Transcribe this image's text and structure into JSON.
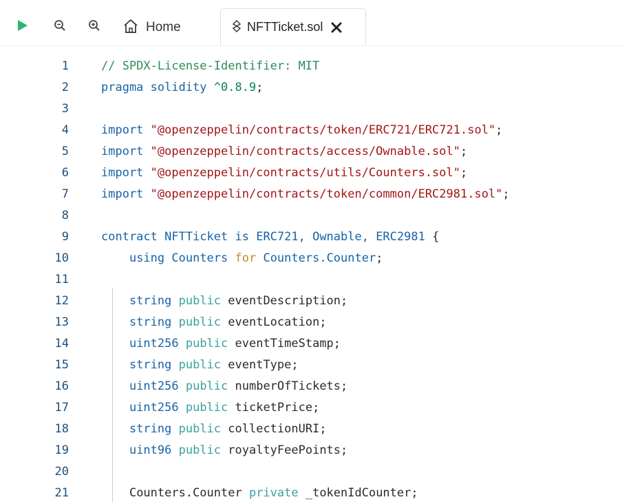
{
  "toolbar": {
    "home_tab_label": "Home",
    "active_tab_label": "NFTTicket.sol"
  },
  "editor": {
    "lines": [
      {
        "n": "1",
        "tokens": [
          {
            "t": "// SPDX-License-Identifier: MIT",
            "k": "comment"
          }
        ]
      },
      {
        "n": "2",
        "tokens": [
          {
            "t": "pragma solidity ",
            "k": "kw"
          },
          {
            "t": "^0.8.9",
            "k": "num"
          },
          {
            "t": ";",
            "k": "plain"
          }
        ]
      },
      {
        "n": "3",
        "tokens": []
      },
      {
        "n": "4",
        "tokens": [
          {
            "t": "import ",
            "k": "kw"
          },
          {
            "t": "\"@openzeppelin/contracts/token/ERC721/ERC721.sol\"",
            "k": "str"
          },
          {
            "t": ";",
            "k": "plain"
          }
        ]
      },
      {
        "n": "5",
        "tokens": [
          {
            "t": "import ",
            "k": "kw"
          },
          {
            "t": "\"@openzeppelin/contracts/access/Ownable.sol\"",
            "k": "str"
          },
          {
            "t": ";",
            "k": "plain"
          }
        ]
      },
      {
        "n": "6",
        "tokens": [
          {
            "t": "import ",
            "k": "kw"
          },
          {
            "t": "\"@openzeppelin/contracts/utils/Counters.sol\"",
            "k": "str"
          },
          {
            "t": ";",
            "k": "plain"
          }
        ]
      },
      {
        "n": "7",
        "tokens": [
          {
            "t": "import ",
            "k": "kw"
          },
          {
            "t": "\"@openzeppelin/contracts/token/common/ERC2981.sol\"",
            "k": "str"
          },
          {
            "t": ";",
            "k": "plain"
          }
        ]
      },
      {
        "n": "8",
        "tokens": []
      },
      {
        "n": "9",
        "tokens": [
          {
            "t": "contract ",
            "k": "kw"
          },
          {
            "t": "NFTTicket ",
            "k": "kw"
          },
          {
            "t": "is ",
            "k": "kw"
          },
          {
            "t": "ERC721, Ownable, ERC2981 ",
            "k": "kw"
          },
          {
            "t": "{",
            "k": "plain"
          }
        ]
      },
      {
        "n": "10",
        "tokens": [
          {
            "t": "    ",
            "k": "plain"
          },
          {
            "t": "using ",
            "k": "kw"
          },
          {
            "t": "Counters ",
            "k": "kw"
          },
          {
            "t": "for ",
            "k": "gold"
          },
          {
            "t": "Counters.Counter",
            "k": "kw"
          },
          {
            "t": ";",
            "k": "plain"
          }
        ]
      },
      {
        "n": "11",
        "tokens": []
      },
      {
        "n": "12",
        "tokens": [
          {
            "t": "    ",
            "k": "plain"
          },
          {
            "t": "string ",
            "k": "type"
          },
          {
            "t": "public ",
            "k": "mod"
          },
          {
            "t": "eventDescription;",
            "k": "plain"
          }
        ]
      },
      {
        "n": "13",
        "tokens": [
          {
            "t": "    ",
            "k": "plain"
          },
          {
            "t": "string ",
            "k": "type"
          },
          {
            "t": "public ",
            "k": "mod"
          },
          {
            "t": "eventLocation;",
            "k": "plain"
          }
        ]
      },
      {
        "n": "14",
        "tokens": [
          {
            "t": "    ",
            "k": "plain"
          },
          {
            "t": "uint256 ",
            "k": "type"
          },
          {
            "t": "public ",
            "k": "mod"
          },
          {
            "t": "eventTimeStamp;",
            "k": "plain"
          }
        ]
      },
      {
        "n": "15",
        "tokens": [
          {
            "t": "    ",
            "k": "plain"
          },
          {
            "t": "string ",
            "k": "type"
          },
          {
            "t": "public ",
            "k": "mod"
          },
          {
            "t": "eventType;",
            "k": "plain"
          }
        ]
      },
      {
        "n": "16",
        "tokens": [
          {
            "t": "    ",
            "k": "plain"
          },
          {
            "t": "uint256 ",
            "k": "type"
          },
          {
            "t": "public ",
            "k": "mod"
          },
          {
            "t": "numberOfTickets;",
            "k": "plain"
          }
        ]
      },
      {
        "n": "17",
        "tokens": [
          {
            "t": "    ",
            "k": "plain"
          },
          {
            "t": "uint256 ",
            "k": "type"
          },
          {
            "t": "public ",
            "k": "mod"
          },
          {
            "t": "ticketPrice;",
            "k": "plain"
          }
        ]
      },
      {
        "n": "18",
        "tokens": [
          {
            "t": "    ",
            "k": "plain"
          },
          {
            "t": "string ",
            "k": "type"
          },
          {
            "t": "public ",
            "k": "mod"
          },
          {
            "t": "collectionURI;",
            "k": "plain"
          }
        ]
      },
      {
        "n": "19",
        "tokens": [
          {
            "t": "    ",
            "k": "plain"
          },
          {
            "t": "uint96 ",
            "k": "type"
          },
          {
            "t": "public ",
            "k": "mod"
          },
          {
            "t": "royaltyFeePoints;",
            "k": "plain"
          }
        ]
      },
      {
        "n": "20",
        "tokens": []
      },
      {
        "n": "21",
        "tokens": [
          {
            "t": "    ",
            "k": "plain"
          },
          {
            "t": "Counters.Counter ",
            "k": "plain"
          },
          {
            "t": "private ",
            "k": "mod"
          },
          {
            "t": "_tokenIdCounter;",
            "k": "plain"
          }
        ]
      }
    ]
  }
}
